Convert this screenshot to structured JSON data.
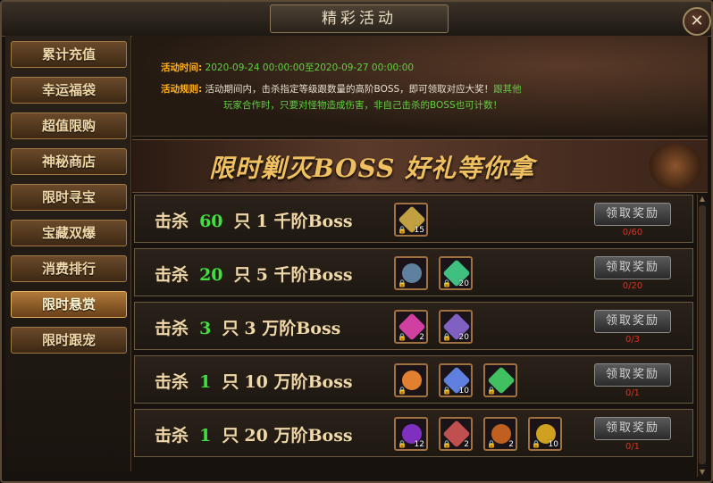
{
  "window": {
    "title": "精彩活动",
    "close_icon": "✕"
  },
  "sidebar": {
    "items": [
      {
        "label": "累计充值",
        "active": false
      },
      {
        "label": "幸运福袋",
        "active": false
      },
      {
        "label": "超值限购",
        "active": false
      },
      {
        "label": "神秘商店",
        "active": false
      },
      {
        "label": "限时寻宝",
        "active": false
      },
      {
        "label": "宝藏双爆",
        "active": false
      },
      {
        "label": "消费排行",
        "active": false
      },
      {
        "label": "限时悬赏",
        "active": true
      },
      {
        "label": "限时跟宠",
        "active": false
      }
    ]
  },
  "info": {
    "time_label": "活动时间:",
    "time_value": "2020-09-24 00:00:00至2020-09-27 00:00:00",
    "rules_label": "活动规则:",
    "rules_white": "活动期间内，击杀指定等级跟数量的高阶BOSS，即可领取对应大奖！",
    "rules_green_1": "跟其他",
    "rules_green_2": "玩家合作时，只要对怪物造成伤害，非自己击杀的BOSS也可计数！"
  },
  "banner": {
    "text": "限时剿灭BOSS   好礼等你拿"
  },
  "rows": [
    {
      "kill": "击杀",
      "count": "60",
      "unit": "只",
      "level": "1 千阶Boss",
      "button": "领取奖励",
      "progress": "0/60",
      "items": [
        {
          "icon": "treasure-chest-icon",
          "count": "15",
          "color": "#c0a040"
        }
      ]
    },
    {
      "kill": "击杀",
      "count": "20",
      "unit": "只",
      "level": "5 千阶Boss",
      "button": "领取奖励",
      "progress": "0/20",
      "items": [
        {
          "icon": "compass-icon",
          "count": "",
          "color": "#6080a0"
        },
        {
          "icon": "crystal-icon",
          "count": "20",
          "color": "#40c080"
        }
      ]
    },
    {
      "kill": "击杀",
      "count": "3",
      "unit": "只",
      "level": "3 万阶Boss",
      "button": "领取奖励",
      "progress": "0/3",
      "items": [
        {
          "icon": "pink-gem-icon",
          "count": "2",
          "color": "#d040a0"
        },
        {
          "icon": "purple-crystal-icon",
          "count": "20",
          "color": "#8060c0"
        }
      ]
    },
    {
      "kill": "击杀",
      "count": "1",
      "unit": "只",
      "level": "10 万阶Boss",
      "button": "领取奖励",
      "progress": "0/1",
      "items": [
        {
          "icon": "rainbow-orb-icon",
          "count": "",
          "color": "#e08030"
        },
        {
          "icon": "feather-icon",
          "count": "10",
          "color": "#6080e0"
        },
        {
          "icon": "green-crystal-icon",
          "count": "",
          "color": "#40c060"
        }
      ]
    },
    {
      "kill": "击杀",
      "count": "1",
      "unit": "只",
      "level": "20 万阶Boss",
      "button": "领取奖励",
      "progress": "0/1",
      "items": [
        {
          "icon": "purple-orb-icon",
          "count": "12",
          "color": "#8030c0"
        },
        {
          "icon": "red-crystal-icon",
          "count": "2",
          "color": "#c05050"
        },
        {
          "icon": "fire-orb-icon",
          "count": "2",
          "color": "#c06020"
        },
        {
          "icon": "gold-coin-icon",
          "count": "10",
          "color": "#d0a020"
        }
      ]
    }
  ]
}
